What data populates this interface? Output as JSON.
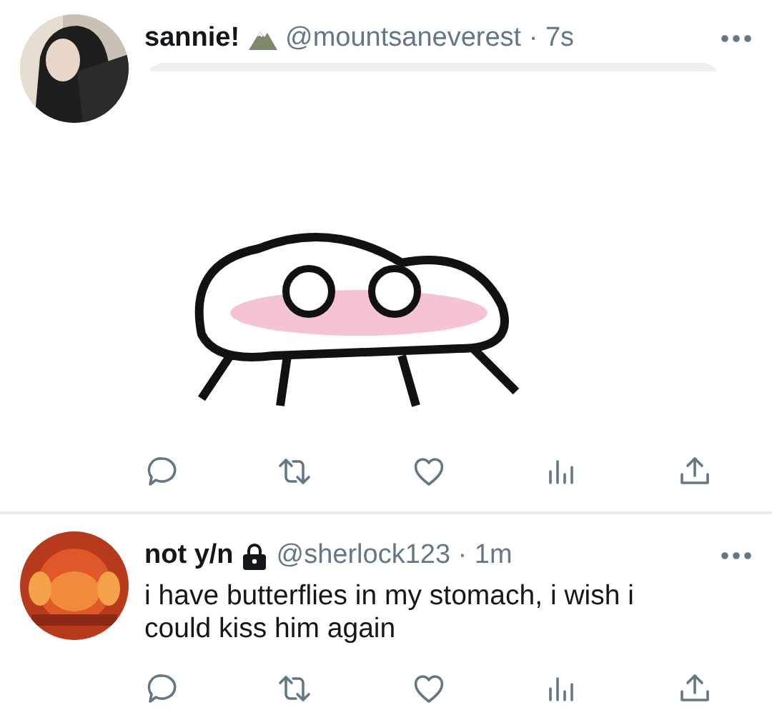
{
  "tweets": [
    {
      "name": "sannie!",
      "name_emoji": true,
      "protected": false,
      "meta": "@mountsaneverest · 7s"
    },
    {
      "name": "not y/n",
      "name_emoji": false,
      "protected": true,
      "meta": "@sherlock123 · 1m",
      "text": "i have butterflies in my stomach, i wish i could kiss him again"
    }
  ]
}
